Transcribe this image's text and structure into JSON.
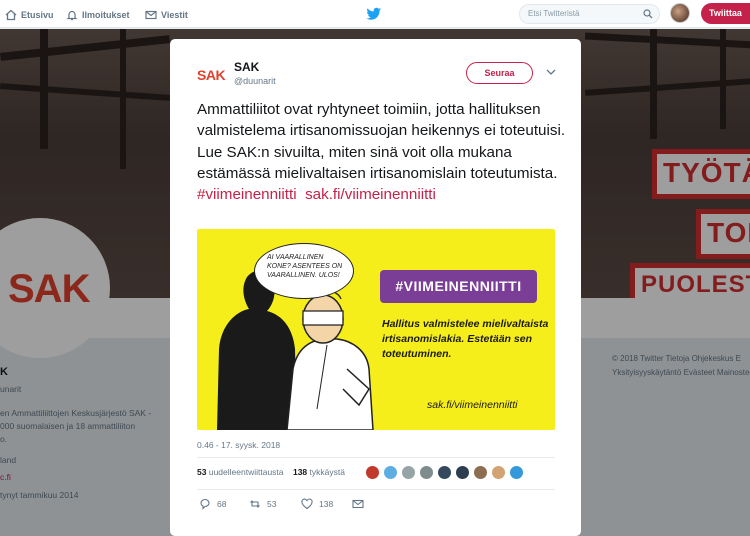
{
  "nav": {
    "home": "Etusivu",
    "notifications": "Ilmoitukset",
    "messages": "Viestit",
    "search_placeholder": "Etsi Twitteristä",
    "tweet_button": "Twiittaa"
  },
  "background_profile": {
    "banner_signs": [
      "TYÖTÄ",
      "TOI",
      "PUOLEST"
    ],
    "avatar_text": "SAK",
    "name_fragment": "K",
    "handle_fragment": "unarit",
    "bio_line1": "en Ammattiliittojen Keskusjärjestö SAK -",
    "bio_line2": "000 suomalaisen ja 18 ammattiliiton",
    "bio_line3": "o.",
    "location": "land",
    "website": "c.fi",
    "joined": "tynyt tammikuu 2014",
    "footer_line1": "© 2018 Twitter   Tietoja   Ohjekeskus   E",
    "footer_line2": "Yksityisyyskäytäntö   Evästeet   Mainosten"
  },
  "tweet": {
    "logo": "SAK",
    "author_name": "SAK",
    "author_handle": "@duunarit",
    "follow_label": "Seuraa",
    "text_main": "Ammattiliitot ovat ryhtyneet toimiin, jotta hallituksen valmistelema irtisanomissuojan heikennys ei toteutuisi. Lue SAK:n sivuilta, miten sinä voit olla mukana estämässä mielivaltaisen irtisanomislain toteutumista.",
    "hashtag": "#viimeinenniitti",
    "link": "sak.fi/viimeinenniitti",
    "timestamp": "0.46 - 17. syysk. 2018",
    "retweets_count": "53",
    "retweets_label": "uudelleentwiittausta",
    "likes_count": "138",
    "likes_label": "tykkäystä",
    "reply_count": "68",
    "retweet_action_count": "53",
    "like_action_count": "138"
  },
  "media": {
    "speech_bubble": "AI VAARALLINEN KONE? ASENTEES ON VAARALLINEN. ULOS!",
    "tag": "#VIIMEINENNIITTI",
    "body": "Hallitus valmistelee mielivaltaista irtisanomislakia. Estetään sen toteutuminen.",
    "url": "sak.fi/viimeinenniitti"
  },
  "colors": {
    "brand_red": "#c4224a",
    "sak_red": "#e0422d",
    "media_yellow": "#f6ee1b",
    "tag_purple": "#7a3e97"
  }
}
